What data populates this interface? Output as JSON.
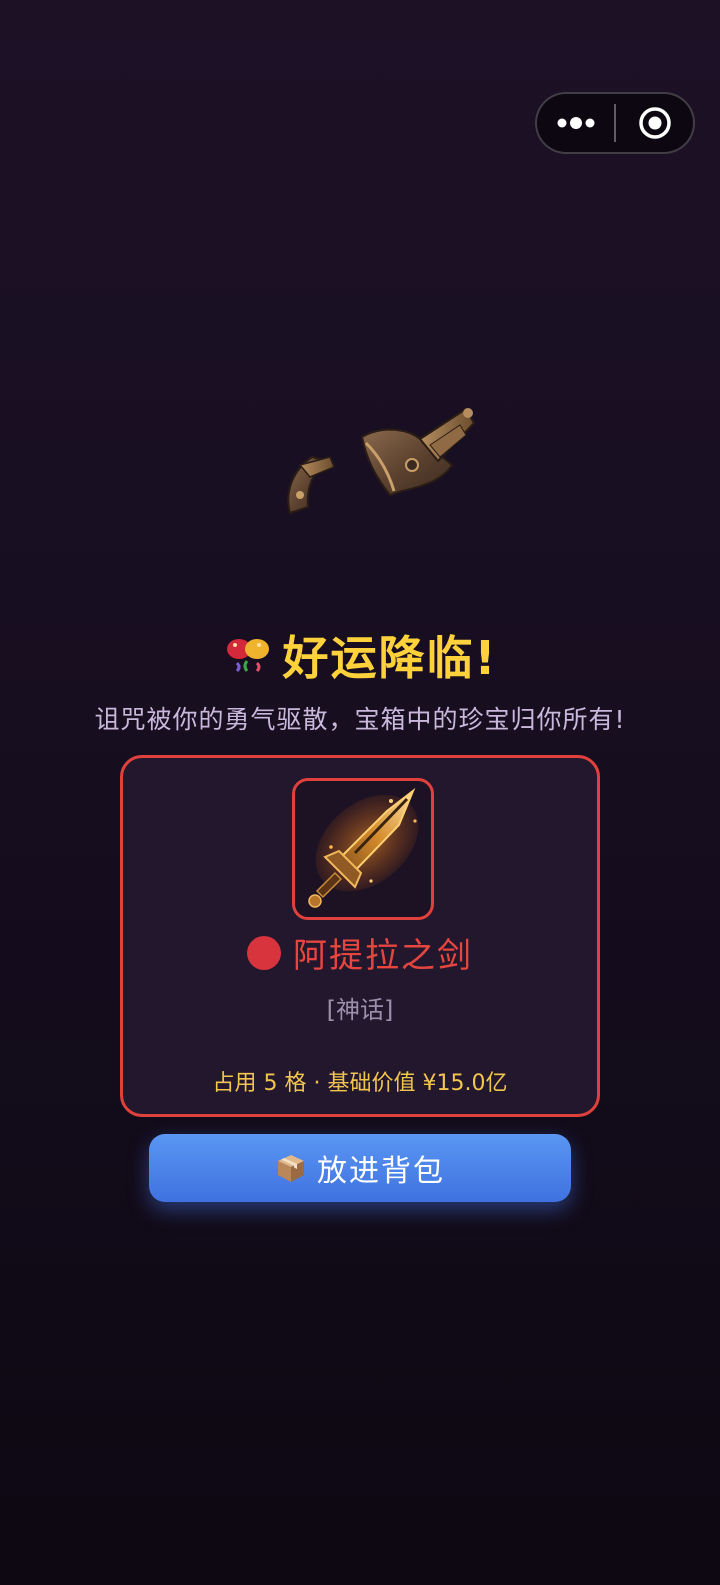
{
  "capsule": {
    "more_icon": "more-dots-icon",
    "close_icon": "target-close-icon"
  },
  "chest": {
    "icon": "opened-treasure-chest"
  },
  "header": {
    "emoji_icon": "party-popper-icon",
    "title": "好运降临!",
    "subtitle": "诅咒被你的勇气驱散，宝箱中的珍宝归你所有!"
  },
  "item": {
    "icon": "flaming-sword-icon",
    "name": "阿提拉之剑",
    "rarity": "[神话]",
    "info": "占用 5 格 · 基础价值 ¥15.0亿",
    "rarity_color": "#d8343d",
    "accent_color": "#e0413c"
  },
  "action": {
    "icon": "package-box-icon",
    "label": "放进背包",
    "color": "#4a84ea"
  },
  "colors": {
    "title": "#ffd23c",
    "subtitle": "#c9b8dc",
    "info": "#f2c54d"
  }
}
